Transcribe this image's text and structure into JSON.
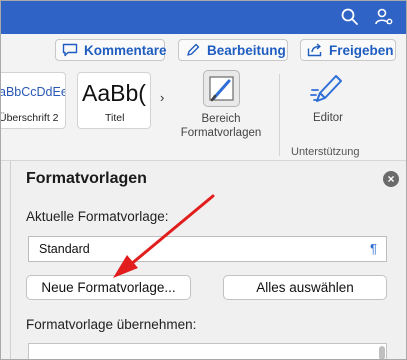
{
  "ribbon": {
    "comments_label": "Kommentare",
    "editing_label": "Bearbeitung",
    "share_label": "Freigeben",
    "styles": [
      {
        "sample": "aBbCcDdEe",
        "name": "Überschrift 2"
      },
      {
        "sample": "AaBb(",
        "name": "Titel"
      }
    ],
    "more_glyph": "›",
    "styles_pane_label_1": "Bereich",
    "styles_pane_label_2": "Formatvorlagen",
    "editor_label": "Editor",
    "group_label": "Unterstützung"
  },
  "pane": {
    "title": "Formatvorlagen",
    "current_style_label": "Aktuelle Formatvorlage:",
    "current_style_value": "Standard",
    "pilcrow": "¶",
    "new_style_button": "Neue Formatvorlage...",
    "select_all_button": "Alles auswählen",
    "apply_style_label": "Formatvorlage übernehmen:"
  },
  "colors": {
    "titlebar": "#2f63c6",
    "accent_blue": "#1f5dc0",
    "annotation_arrow": "#e11d1d"
  }
}
